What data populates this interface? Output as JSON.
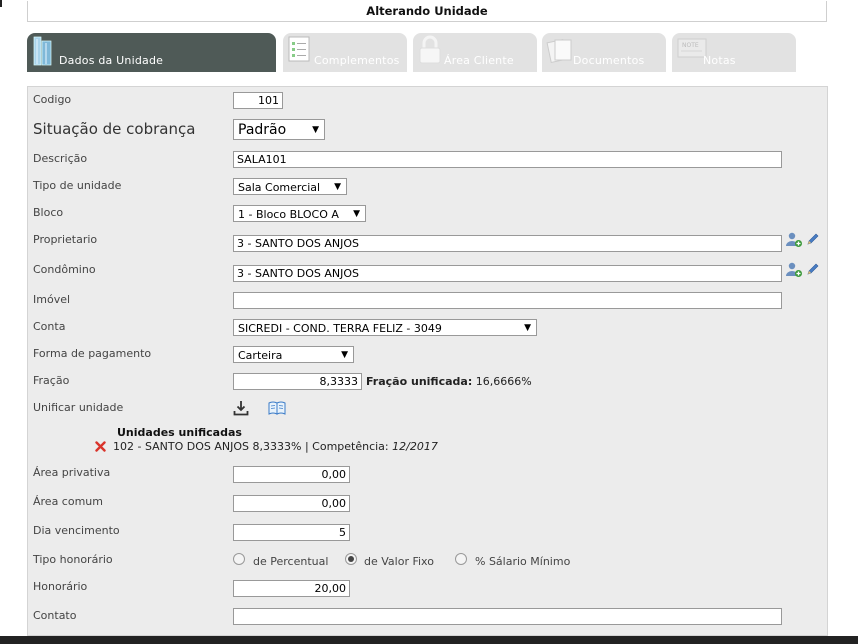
{
  "header": {
    "title": "Alterando Unidade"
  },
  "tabs": [
    {
      "label": "Dados da Unidade",
      "icon": "building-icon",
      "active": true
    },
    {
      "label": "Complementos",
      "icon": "checklist-icon",
      "active": false
    },
    {
      "label": "Área Cliente",
      "icon": "lock-icon",
      "active": false
    },
    {
      "label": "Documentos",
      "icon": "documents-icon",
      "active": false
    },
    {
      "label": "Notas",
      "icon": "note-icon",
      "active": false
    }
  ],
  "form": {
    "codigo": {
      "label": "Codigo",
      "value": "101"
    },
    "situacao": {
      "label": "Situação de cobrança",
      "value": "Padrão"
    },
    "descricao": {
      "label": "Descrição",
      "value": "SALA101"
    },
    "tipo_unidade": {
      "label": "Tipo de unidade",
      "value": "Sala Comercial"
    },
    "bloco": {
      "label": "Bloco",
      "value": "1 - Bloco BLOCO A"
    },
    "proprietario": {
      "label": "Proprietario",
      "value": "3 - SANTO DOS ANJOS"
    },
    "condomino": {
      "label": "Condômino",
      "value": "3 - SANTO DOS ANJOS"
    },
    "imovel": {
      "label": "Imóvel",
      "value": ""
    },
    "conta": {
      "label": "Conta",
      "value": "SICREDI - COND. TERRA FELIZ - 3049"
    },
    "forma_pagamento": {
      "label": "Forma de pagamento",
      "value": "Carteira"
    },
    "fracao": {
      "label": "Fração",
      "value": "8,3333",
      "unificada_label": "Fração unificada:",
      "unificada_value": "16,6666%"
    },
    "unificar": {
      "label": "Unificar unidade"
    },
    "unidades_unificadas": {
      "heading": "Unidades unificadas",
      "items": [
        {
          "text": "102 - SANTO DOS ANJOS 8,3333% | Competência:",
          "competencia": "12/2017"
        }
      ]
    },
    "area_privativa": {
      "label": "Área privativa",
      "value": "0,00"
    },
    "area_comum": {
      "label": "Área comum",
      "value": "0,00"
    },
    "dia_vencimento": {
      "label": "Dia vencimento",
      "value": "5"
    },
    "tipo_honorario": {
      "label": "Tipo honorário",
      "options": [
        "de Percentual",
        "de Valor Fixo",
        "% Sálario Mínimo"
      ],
      "selected": "de Valor Fixo"
    },
    "honorario": {
      "label": "Honorário",
      "value": "20,00"
    },
    "contato": {
      "label": "Contato",
      "value": ""
    }
  },
  "colors": {
    "active_tab": "#4f5a57",
    "inactive_tab": "#e2e2e2",
    "panel": "#ececec",
    "delete": "#d9342b",
    "link_blue": "#3a7bc8"
  }
}
